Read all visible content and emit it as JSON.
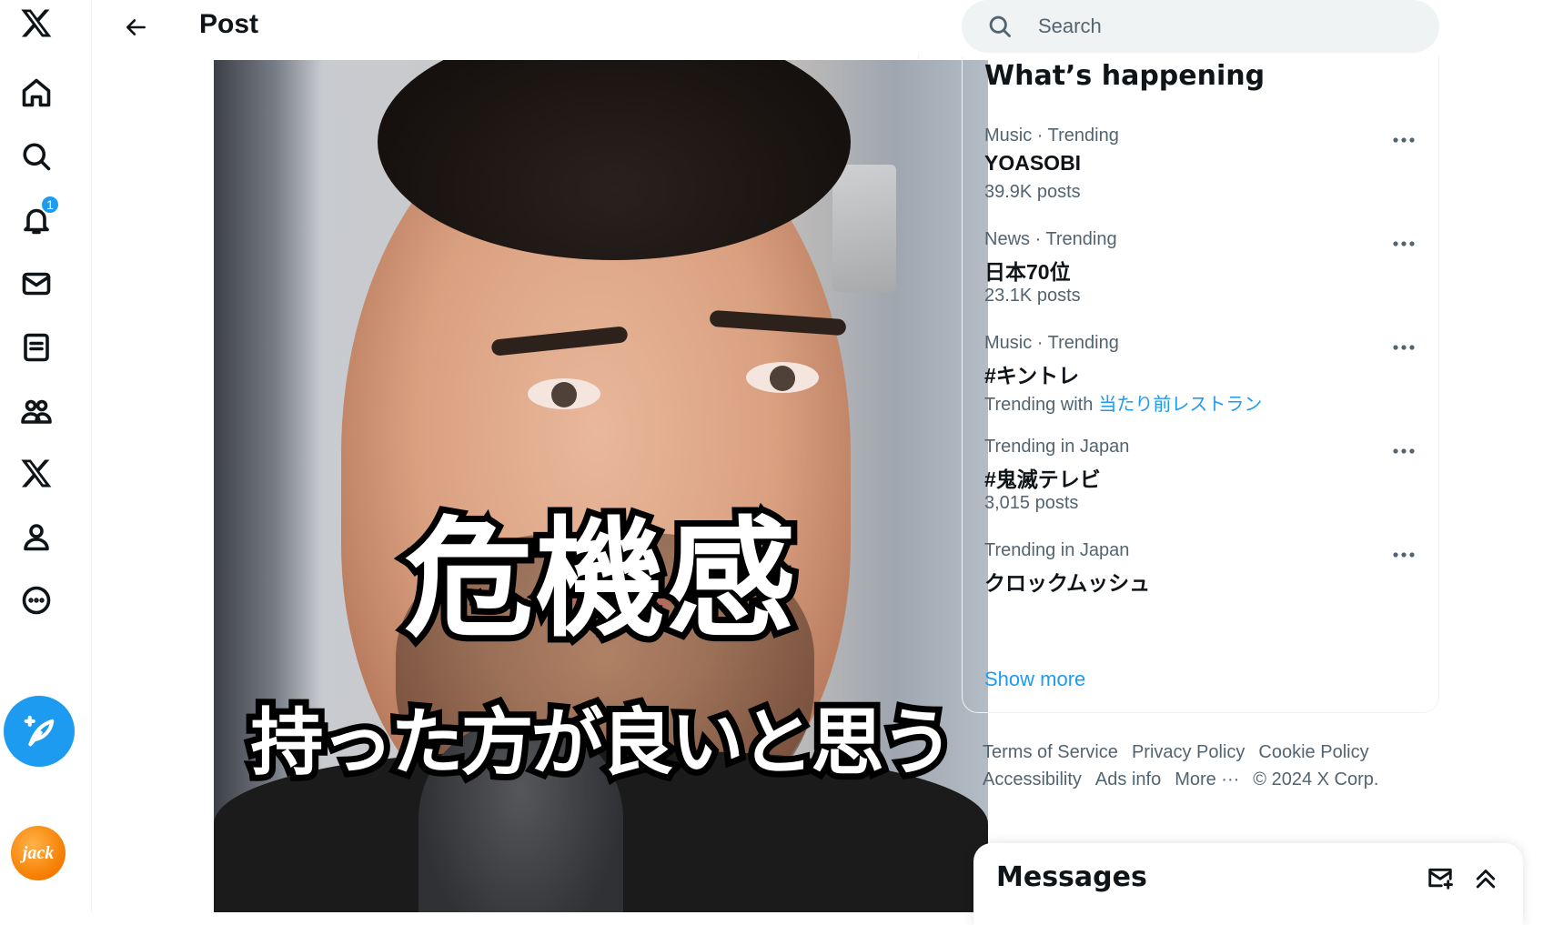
{
  "header": {
    "title": "Post"
  },
  "video": {
    "caption_line1": "危機感",
    "caption_line2": "持った方が良いと思う"
  },
  "nav": {
    "notification_count": "1",
    "avatar_text": "jack"
  },
  "search": {
    "placeholder": "Search"
  },
  "trends": {
    "heading": "What’s happening",
    "items": [
      {
        "category": "Music · Trending",
        "name": "YOASOBI",
        "count": "39.9K posts"
      },
      {
        "category": "News · Trending",
        "name": "日本70位",
        "count": "23.1K posts"
      },
      {
        "category": "Music · Trending",
        "name": "#キントレ",
        "count": "Trending with",
        "with_link": "当たり前レストラン"
      },
      {
        "category": "Trending in Japan",
        "name": "#鬼滅テレビ",
        "count": "3,015 posts"
      },
      {
        "category": "Trending in Japan",
        "name": "クロックムッシュ",
        "count": ""
      }
    ],
    "show_more": "Show more"
  },
  "footer": {
    "links": [
      "Terms of Service",
      "Privacy Policy",
      "Cookie Policy",
      "Accessibility",
      "Ads info",
      "More ···"
    ],
    "copyright": "© 2024 X Corp."
  },
  "messages": {
    "title": "Messages"
  },
  "colors": {
    "accent": "#1d9bf0",
    "text": "#0f1419",
    "secondary": "#536471"
  }
}
